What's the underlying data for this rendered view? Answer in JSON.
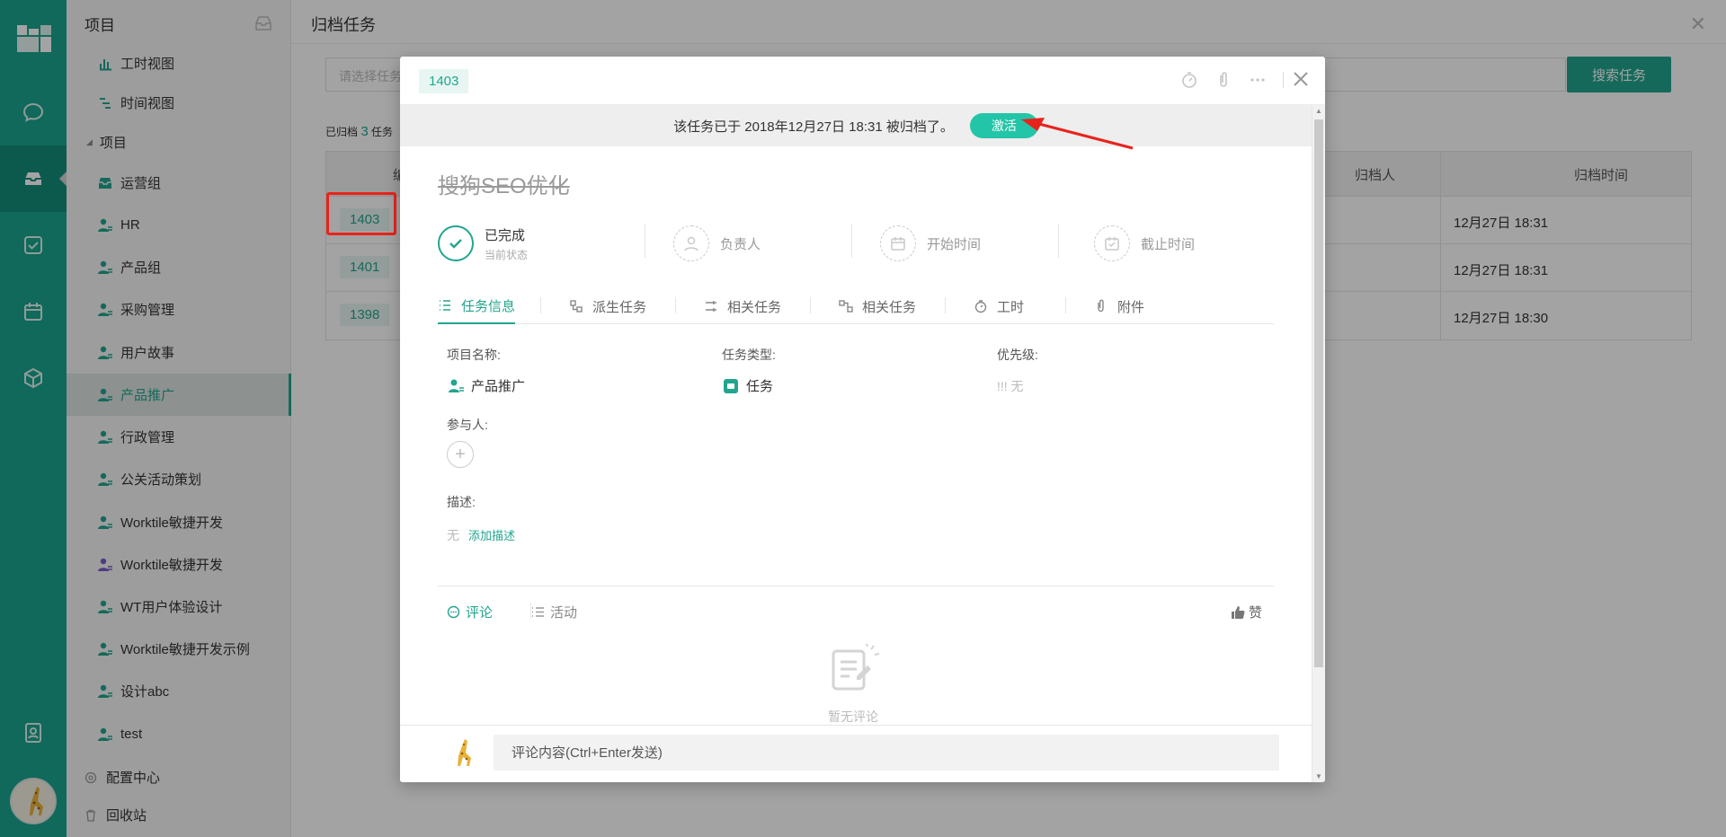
{
  "sidebar": {
    "header": "项目",
    "items": [
      {
        "label": "工时视图",
        "icon": "bar-chart-icon",
        "indent": 1
      },
      {
        "label": "时间视图",
        "icon": "gantt-icon",
        "indent": 1
      },
      {
        "label": "项目",
        "icon": "caret-icon",
        "indent": 0
      },
      {
        "label": "运营组",
        "icon": "inbox-folder-icon",
        "indent": 1
      },
      {
        "label": "HR",
        "icon": "people-icon",
        "indent": 1
      },
      {
        "label": "产品组",
        "icon": "people-icon",
        "indent": 1
      },
      {
        "label": "采购管理",
        "icon": "people-icon",
        "indent": 1
      },
      {
        "label": "用户故事",
        "icon": "people-icon",
        "indent": 1
      },
      {
        "label": "产品推广",
        "icon": "people-icon",
        "indent": 1
      },
      {
        "label": "行政管理",
        "icon": "people-icon",
        "indent": 1
      },
      {
        "label": "公关活动策划",
        "icon": "people-icon",
        "indent": 1
      },
      {
        "label": "Worktile敏捷开发",
        "icon": "people-icon",
        "indent": 1
      },
      {
        "label": "Worktile敏捷开发",
        "icon": "people-purple-icon",
        "indent": 1
      },
      {
        "label": "WT用户体验设计",
        "icon": "people-icon",
        "indent": 1
      },
      {
        "label": "Worktile敏捷开发示例",
        "icon": "people-icon",
        "indent": 1
      },
      {
        "label": "设计abc",
        "icon": "people-icon",
        "indent": 1
      },
      {
        "label": "test",
        "icon": "people-icon",
        "indent": 1
      },
      {
        "label": "配置中心",
        "icon": "settings-icon",
        "indent": 0
      },
      {
        "label": "回收站",
        "icon": "trash-icon",
        "indent": 0
      }
    ],
    "active_index": 8
  },
  "page": {
    "title": "归档任务",
    "search_placeholder": "请选择任务",
    "search_button": "搜索任务",
    "archived_prefix": "已归档",
    "archived_count": "3",
    "archived_suffix": "任务",
    "table": {
      "col_first": "编",
      "col_archiver": "归档人",
      "col_time": "归档时间",
      "rows": [
        {
          "id": "1403",
          "time": "12月27日 18:31"
        },
        {
          "id": "1401",
          "time": "12月27日 18:31"
        },
        {
          "id": "1398",
          "time": "12月27日 18:30"
        }
      ]
    }
  },
  "modal": {
    "task_id": "1403",
    "notice": "该任务已于 2018年12月27日 18:31 被归档了。",
    "activate": "激活",
    "title": "搜狗SEO优化",
    "status": {
      "label": "已完成",
      "sub": "当前状态"
    },
    "assignee": "负责人",
    "start_time": "开始时间",
    "due_time": "截止时间",
    "tabs": [
      "任务信息",
      "派生任务",
      "相关任务",
      "相关任务",
      "工时",
      "附件"
    ],
    "fields": {
      "project_label": "项目名称:",
      "project_value": "产品推广",
      "type_label": "任务类型:",
      "type_value": "任务",
      "priority_label": "优先级:",
      "priority_value": "!!! 无",
      "members_label": "参与人:",
      "desc_label": "描述:",
      "desc_none": "无",
      "desc_add": "添加描述"
    },
    "comment_tab": "评论",
    "activity_tab": "活动",
    "like": "赞",
    "empty_comments": "暂无评论",
    "comment_placeholder": "评论内容(Ctrl+Enter发送)"
  },
  "colors": {
    "brand": "#22a58e",
    "rail": "#1aa58e",
    "highlight": "#e8231c"
  }
}
